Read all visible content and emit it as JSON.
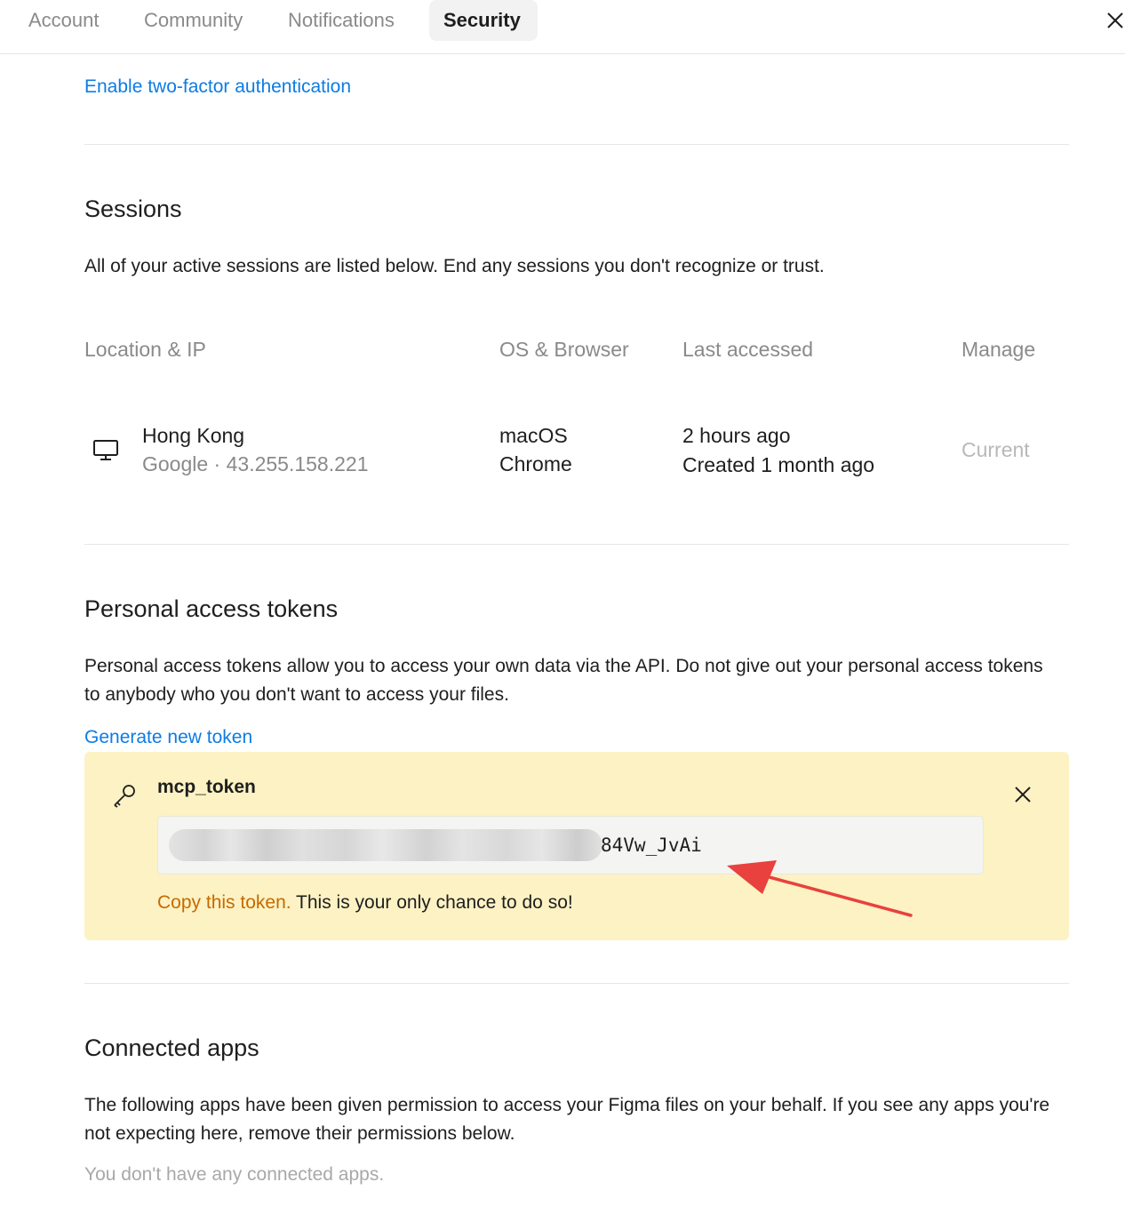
{
  "tabs": [
    {
      "label": "Account"
    },
    {
      "label": "Community"
    },
    {
      "label": "Notifications"
    },
    {
      "label": "Security",
      "active": true
    }
  ],
  "two_factor_link": "Enable two-factor authentication",
  "sessions": {
    "title": "Sessions",
    "description": "All of your active sessions are listed below. End any sessions you don't recognize or trust.",
    "columns": [
      "Location & IP",
      "OS & Browser",
      "Last accessed",
      "Manage"
    ],
    "rows": [
      {
        "location": "Hong Kong",
        "provider_ip": "Google · 43.255.158.221",
        "os": "macOS",
        "browser": "Chrome",
        "last_accessed": "2 hours ago",
        "created": "Created 1 month ago",
        "manage": "Current",
        "icon": "monitor-icon"
      }
    ]
  },
  "tokens": {
    "title": "Personal access tokens",
    "description": "Personal access tokens allow you to access your own data via the API. Do not give out your personal access tokens to anybody who you don't want to access your files.",
    "generate_link": "Generate new token",
    "new_token": {
      "name": "mcp_token",
      "visible_suffix": "84Vw_JvAi",
      "copy_warning": "Copy this token.",
      "copy_note": " This is your only chance to do so!",
      "bg_color": "#fdf2c4",
      "warning_color": "#c66a00"
    }
  },
  "connected_apps": {
    "title": "Connected apps",
    "description": "The following apps have been given permission to access your Figma files on your behalf. If you see any apps you're not expecting here, remove their permissions below.",
    "empty_text": "You don't have any connected apps."
  },
  "colors": {
    "link": "#0d7ce3",
    "muted": "#8a8a8a",
    "arrow": "#e8413e"
  }
}
